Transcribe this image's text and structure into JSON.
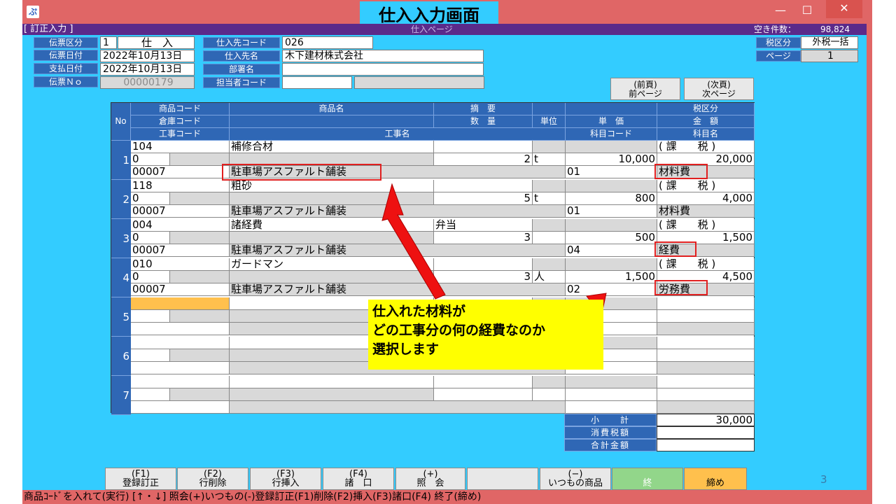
{
  "window": {
    "caption": "仕入入力画面",
    "minimize": "—",
    "maximize": "☐",
    "close": "✕",
    "app_icon": "app-icon"
  },
  "top": {
    "mode": "[ 訂正入力 ]",
    "page_title": "仕入ページ",
    "free_label": "空き件数：",
    "free_count": "98,824"
  },
  "header": {
    "slip_type_label": "伝票区分",
    "slip_type_code": "1",
    "slip_type_name": "仕　入",
    "slip_date_label": "伝票日付",
    "slip_date": "2022年10月13日",
    "pay_date_label": "支払日付",
    "pay_date": "2022年10月13日",
    "slip_no_label": "伝票Ｎｏ",
    "slip_no": "00000179",
    "supplier_code_label": "仕入先コード",
    "supplier_code": "026",
    "supplier_name_label": "仕入先名",
    "supplier_name": "木下建材株式会社",
    "dept_label": "部署名",
    "dept": "",
    "staff_label": "担当者コード",
    "staff": "",
    "tax_type_label": "税区分",
    "tax_type": "外税一括",
    "page_label": "ページ",
    "page": "1"
  },
  "nav": {
    "prev_top": "(前頁)",
    "prev_bottom": "前ページ",
    "next_top": "(次頁)",
    "next_bottom": "次ページ"
  },
  "grid": {
    "headers": {
      "no": "No",
      "item_code": "商品コード",
      "warehouse_code": "倉庫コード",
      "work_code": "工事コード",
      "item_name": "商品名",
      "work_name": "工事名",
      "summary": "摘　要",
      "qty": "数　量",
      "unit": "単位",
      "unit_price": "単　価",
      "account_code": "科目コード",
      "tax_cat": "税区分",
      "amount": "金　額",
      "account_name": "科目名"
    },
    "rows": [
      {
        "no": "1",
        "item_code": "104",
        "item_name": "補修合材",
        "summary": "",
        "tax": "( 課　　税 )",
        "wh": "0",
        "qty": "2",
        "unit": "t",
        "price": "10,000",
        "amount": "20,000",
        "work_code": "00007",
        "work_name": "駐車場アスファルト舗装",
        "acct_code": "01",
        "acct_name": "材料費"
      },
      {
        "no": "2",
        "item_code": "118",
        "item_name": "粗砂",
        "summary": "",
        "tax": "( 課　　税 )",
        "wh": "0",
        "qty": "5",
        "unit": "t",
        "price": "800",
        "amount": "4,000",
        "work_code": "00007",
        "work_name": "駐車場アスファルト舗装",
        "acct_code": "01",
        "acct_name": "材料費"
      },
      {
        "no": "3",
        "item_code": "004",
        "item_name": "諸経費",
        "summary": "弁当",
        "tax": "( 課　　税 )",
        "wh": "0",
        "qty": "3",
        "unit": "",
        "price": "500",
        "amount": "1,500",
        "work_code": "00007",
        "work_name": "駐車場アスファルト舗装",
        "acct_code": "04",
        "acct_name": "経費"
      },
      {
        "no": "4",
        "item_code": "010",
        "item_name": "ガードマン",
        "summary": "",
        "tax": "( 課　　税 )",
        "wh": "0",
        "qty": "3",
        "unit": "人",
        "price": "1,500",
        "amount": "4,500",
        "work_code": "00007",
        "work_name": "駐車場アスファルト舗装",
        "acct_code": "02",
        "acct_name": "労務費"
      },
      {
        "no": "5"
      },
      {
        "no": "6"
      },
      {
        "no": "7"
      }
    ]
  },
  "totals": {
    "subtotal_label": "小　　計",
    "subtotal": "30,000",
    "tax_label": "消費税額",
    "tax": "",
    "total_label": "合計金額",
    "total": ""
  },
  "callout": {
    "line1": "仕入れた材料が",
    "line2": "どの工事分の何の経費なのか",
    "line3": "選択します"
  },
  "fkeys": [
    {
      "top": "(F1)",
      "bottom": "登録訂正"
    },
    {
      "top": "(F2)",
      "bottom": "行削除"
    },
    {
      "top": "(F3)",
      "bottom": "行挿入"
    },
    {
      "top": "(F4)",
      "bottom": "諸　口"
    },
    {
      "top": "(+)",
      "bottom": "照　会"
    },
    {
      "top": "",
      "bottom": ""
    },
    {
      "top": "(−)",
      "bottom": "いつもの商品"
    },
    {
      "top": "",
      "bottom": "終"
    },
    {
      "top": "",
      "bottom": "締め"
    }
  ],
  "slide_number": "3",
  "status": "商品ｺｰﾄﾞを入れて(実行) [↑・↓] 照会(+)いつもの(-)登録訂正(F1)削除(F2)挿入(F3)諸口(F4) 終了(締め)"
}
